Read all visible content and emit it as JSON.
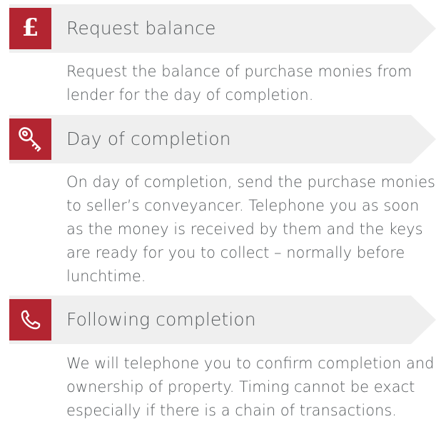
{
  "steps": [
    {
      "icon": "pound-icon",
      "glyph": "£",
      "title": "Request balance",
      "description": "Request the balance of purchase monies from lender for the day of completion."
    },
    {
      "icon": "key-icon",
      "title": "Day of completion",
      "description": "On day of completion, send the purchase monies to seller’s conveyancer. Telephone you as soon as the money is received by them and the keys are ready for you to collect – normally before lunchtime."
    },
    {
      "icon": "phone-icon",
      "title": "Following completion",
      "description": "We will telephone you to confirm completion and ownership of property. Timing cannot be exact especially if there is a chain of transactions."
    }
  ],
  "colors": {
    "accent": "#b32531",
    "banner": "#efefef",
    "text": "#55595c"
  }
}
